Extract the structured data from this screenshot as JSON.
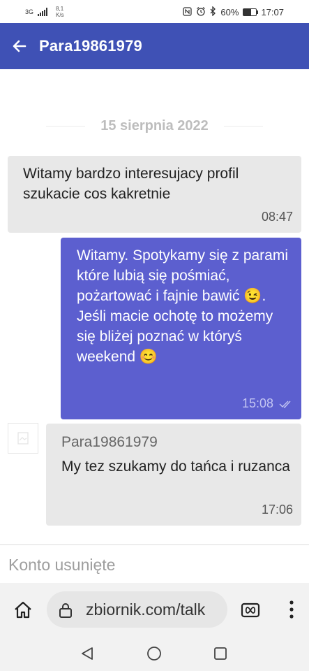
{
  "status": {
    "network": "3G",
    "speed_value": "8,1",
    "speed_unit": "K/s",
    "battery": "60%",
    "battery_level": 0.6,
    "time": "17:07"
  },
  "appbar": {
    "title": "Para19861979"
  },
  "chat": {
    "date_separator": "15 sierpnia 2022",
    "messages": [
      {
        "direction": "incoming",
        "text": "Witamy bardzo interesujacy profil szukacie cos kakretnie",
        "time": "08:47"
      },
      {
        "direction": "outgoing",
        "text_1": "Witamy. Spotykamy się z parami które lubią się pośmiać, pożartować i fajnie bawić",
        "emoji_1": "😉",
        "text_2": ". Jeśli macie ochotę to możemy się bliżej poznać w któryś weekend",
        "emoji_2": "😊",
        "time": "15:08",
        "status_icon": "double-check-icon"
      },
      {
        "direction": "incoming",
        "sender": "Para19861979",
        "text": "My tez szukamy do tańca i ruzanca",
        "time": "17:06"
      }
    ]
  },
  "input": {
    "placeholder": "Konto usunięte"
  },
  "browser": {
    "url": "zbiornik.com/talk"
  },
  "colors": {
    "appbar": "#3f51b5",
    "outgoing_bubble": "#5c5fcf",
    "incoming_bubble": "#e8e8e8"
  }
}
